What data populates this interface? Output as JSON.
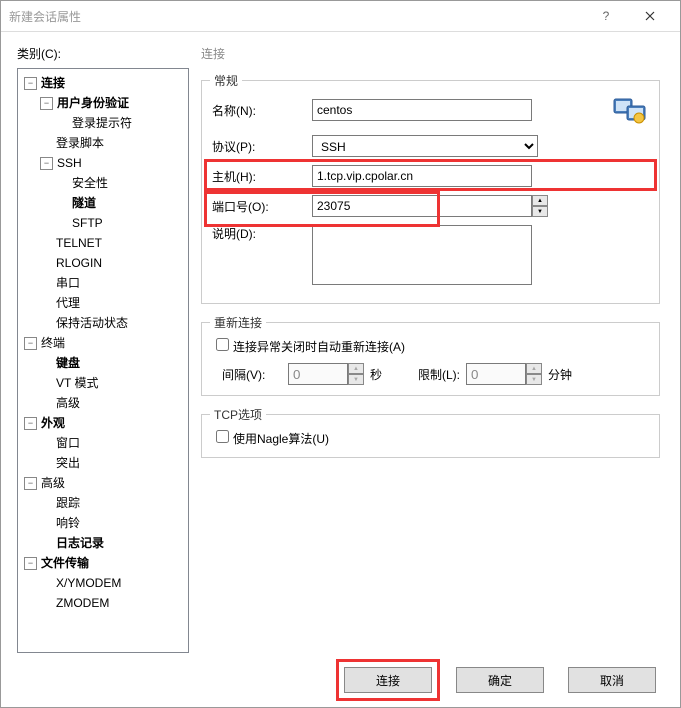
{
  "title": "新建会话属性",
  "category_label": "类别(C):",
  "tree": {
    "connection": "连接",
    "auth": "用户身份验证",
    "login_prompt": "登录提示符",
    "login_script": "登录脚本",
    "ssh": "SSH",
    "security": "安全性",
    "tunnel": "隧道",
    "sftp": "SFTP",
    "telnet": "TELNET",
    "rlogin": "RLOGIN",
    "serial": "串口",
    "proxy": "代理",
    "keepalive": "保持活动状态",
    "terminal": "终端",
    "keyboard": "键盘",
    "vtmode": "VT 模式",
    "adv": "高级",
    "appearance": "外观",
    "window": "窗口",
    "highlight": "突出",
    "adv2": "高级",
    "trace": "跟踪",
    "bell": "响铃",
    "logging": "日志记录",
    "transfer": "文件传输",
    "xymodem": "X/YMODEM",
    "zmodem": "ZMODEM"
  },
  "panel": {
    "title": "连接",
    "general": {
      "legend": "常规",
      "name_label": "名称(N):",
      "name_value": "centos",
      "protocol_label": "协议(P):",
      "protocol_value": "SSH",
      "host_label": "主机(H):",
      "host_value": "1.tcp.vip.cpolar.cn",
      "port_label": "端口号(O):",
      "port_value": "23075",
      "desc_label": "说明(D):",
      "desc_value": ""
    },
    "reconnect": {
      "legend": "重新连接",
      "chk_label": "连接异常关闭时自动重新连接(A)",
      "interval_label": "间隔(V):",
      "interval_value": "0",
      "sec": "秒",
      "limit_label": "限制(L):",
      "limit_value": "0",
      "min": "分钟"
    },
    "tcp": {
      "legend": "TCP选项",
      "nagle_label": "使用Nagle算法(U)"
    }
  },
  "buttons": {
    "connect": "连接",
    "ok": "确定",
    "cancel": "取消"
  }
}
